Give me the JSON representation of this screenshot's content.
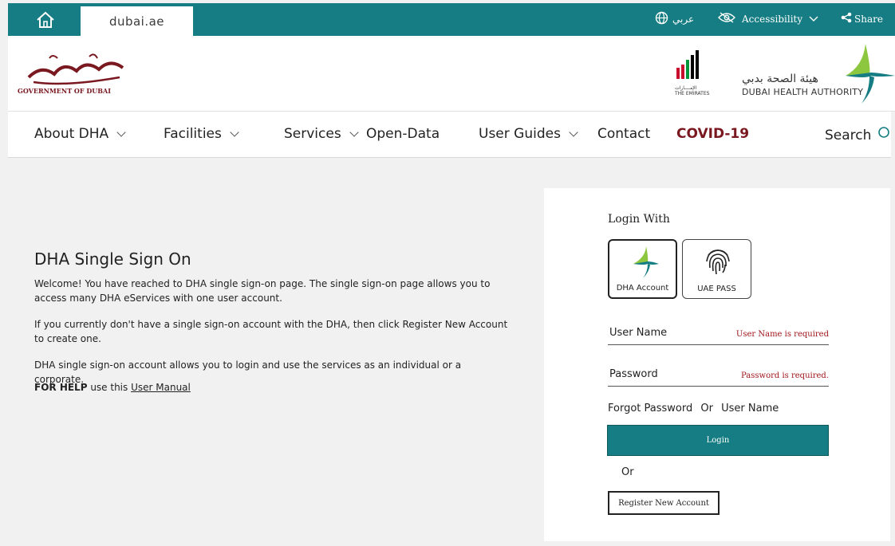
{
  "topbar": {
    "portal_name": "dubai.ae",
    "language_label": "عربي",
    "accessibility_label": "Accessibility",
    "share_label": "Share",
    "home_icon": "home-icon",
    "globe_icon": "globe-icon",
    "eye_icon": "eye-slash-icon",
    "share_icon": "share-icon",
    "color": "#157d83"
  },
  "header": {
    "gov_logo_text": "GOVERNMENT OF DUBAI",
    "gov_logo_arabic": "حكومة دبي",
    "emirates_logo_arabic": "الإمــــارات",
    "emirates_logo_text": "THE EMIRATES",
    "dha_arabic": "هيئة الصحة بدبي",
    "dha_english": "DUBAI HEALTH AUTHORITY"
  },
  "nav": {
    "items": [
      {
        "label": "About DHA",
        "dropdown": true
      },
      {
        "label": "Facilities",
        "dropdown": true
      },
      {
        "label": "Services",
        "dropdown": true
      },
      {
        "label": "Open-Data",
        "dropdown": false
      },
      {
        "label": "User Guides",
        "dropdown": true
      },
      {
        "label": "Contact",
        "dropdown": false
      },
      {
        "label": "COVID-19",
        "dropdown": false
      }
    ],
    "search_label": "Search",
    "covid_color": "#7a1820"
  },
  "main": {
    "title": "DHA Single Sign On",
    "paragraphs": [
      "Welcome! You have reached to DHA single sign-on page. The single sign-on page allows you to access many DHA eServices with one user account.",
      "If you currently don't have a single sign-on account with the DHA, then click Register New Account to create one.",
      "DHA single sign-on account allows you to login and use the services as an individual or a corporate."
    ],
    "help_prefix": "FOR HELP",
    "help_middle": " use this ",
    "help_link": "User Manual"
  },
  "login": {
    "title": "Login With",
    "option_dha": "DHA Account",
    "option_uae": "UAE PASS",
    "username_label": "User Name",
    "username_error": "User Name is required",
    "password_label": "Password",
    "password_error": "Password is required.",
    "forgot_password": "Forgot Password",
    "forgot_or": "Or",
    "forgot_username": "User Name",
    "login_button": "Login",
    "or_text": "Or",
    "register_button": "Register New Account",
    "error_color": "#a0161b"
  }
}
